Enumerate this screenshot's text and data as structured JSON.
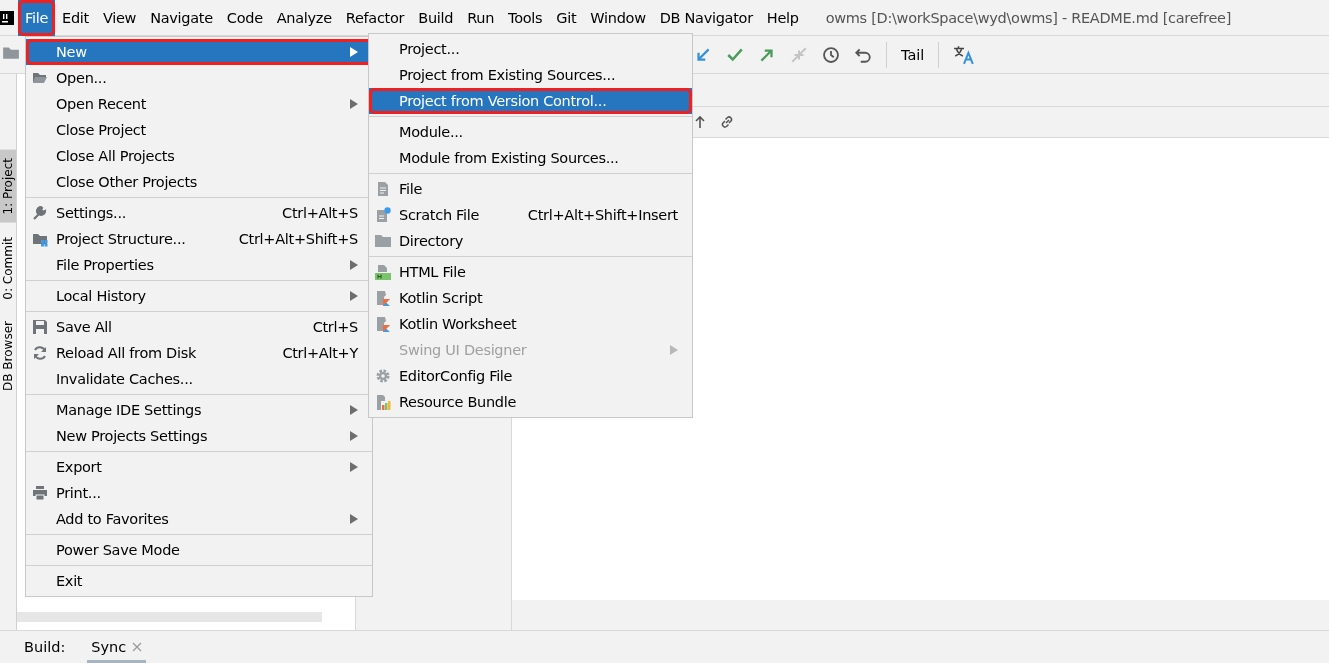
{
  "menubar": {
    "items": [
      {
        "label": "File",
        "selected": true,
        "annotated": true
      },
      {
        "label": "Edit",
        "selected": false,
        "annotated": false
      },
      {
        "label": "View",
        "selected": false,
        "annotated": false
      },
      {
        "label": "Navigate",
        "selected": false,
        "annotated": false
      },
      {
        "label": "Code",
        "selected": false,
        "annotated": false
      },
      {
        "label": "Analyze",
        "selected": false,
        "annotated": false
      },
      {
        "label": "Refactor",
        "selected": false,
        "annotated": false
      },
      {
        "label": "Build",
        "selected": false,
        "annotated": false
      },
      {
        "label": "Run",
        "selected": false,
        "annotated": false
      },
      {
        "label": "Tools",
        "selected": false,
        "annotated": false
      },
      {
        "label": "Git",
        "selected": false,
        "annotated": false
      },
      {
        "label": "Window",
        "selected": false,
        "annotated": false
      },
      {
        "label": "DB Navigator",
        "selected": false,
        "annotated": false
      },
      {
        "label": "Help",
        "selected": false,
        "annotated": false
      }
    ],
    "title": "owms [D:\\workSpace\\wyd\\owms] - README.md [carefree]"
  },
  "toolbar": {
    "tail_label": "Tail"
  },
  "side_tabs": [
    {
      "label": "1: Project",
      "selected": true
    },
    {
      "label": "0: Commit",
      "selected": false
    },
    {
      "label": "DB Browser",
      "selected": false
    }
  ],
  "file_menu": [
    {
      "kind": "item",
      "label": "New",
      "submenu": true,
      "selected": true,
      "annotated": true
    },
    {
      "kind": "item",
      "label": "Open...",
      "submenu": false,
      "selected": false,
      "annotated": false
    },
    {
      "kind": "item",
      "label": "Open Recent",
      "submenu": true,
      "selected": false,
      "annotated": false
    },
    {
      "kind": "item",
      "label": "Close Project",
      "submenu": false,
      "selected": false,
      "annotated": false
    },
    {
      "kind": "item",
      "label": "Close All Projects",
      "submenu": false,
      "selected": false,
      "annotated": false
    },
    {
      "kind": "item",
      "label": "Close Other Projects",
      "submenu": false,
      "selected": false,
      "annotated": false
    },
    {
      "kind": "separator"
    },
    {
      "kind": "item",
      "label": "Settings...",
      "shortcut": "Ctrl+Alt+S",
      "submenu": false,
      "selected": false,
      "annotated": false
    },
    {
      "kind": "item",
      "label": "Project Structure...",
      "shortcut": "Ctrl+Alt+Shift+S",
      "submenu": false,
      "selected": false,
      "annotated": false
    },
    {
      "kind": "item",
      "label": "File Properties",
      "submenu": true,
      "selected": false,
      "annotated": false
    },
    {
      "kind": "separator"
    },
    {
      "kind": "item",
      "label": "Local History",
      "submenu": true,
      "selected": false,
      "annotated": false
    },
    {
      "kind": "separator"
    },
    {
      "kind": "item",
      "label": "Save All",
      "shortcut": "Ctrl+S",
      "submenu": false,
      "selected": false,
      "annotated": false
    },
    {
      "kind": "item",
      "label": "Reload All from Disk",
      "shortcut": "Ctrl+Alt+Y",
      "submenu": false,
      "selected": false,
      "annotated": false
    },
    {
      "kind": "item",
      "label": "Invalidate Caches...",
      "submenu": false,
      "selected": false,
      "annotated": false
    },
    {
      "kind": "separator"
    },
    {
      "kind": "item",
      "label": "Manage IDE Settings",
      "submenu": true,
      "selected": false,
      "annotated": false
    },
    {
      "kind": "item",
      "label": "New Projects Settings",
      "submenu": true,
      "selected": false,
      "annotated": false
    },
    {
      "kind": "separator"
    },
    {
      "kind": "item",
      "label": "Export",
      "submenu": true,
      "selected": false,
      "annotated": false
    },
    {
      "kind": "item",
      "label": "Print...",
      "submenu": false,
      "selected": false,
      "annotated": false
    },
    {
      "kind": "item",
      "label": "Add to Favorites",
      "submenu": true,
      "selected": false,
      "annotated": false
    },
    {
      "kind": "separator"
    },
    {
      "kind": "item",
      "label": "Power Save Mode",
      "submenu": false,
      "selected": false,
      "annotated": false
    },
    {
      "kind": "separator"
    },
    {
      "kind": "item",
      "label": "Exit",
      "submenu": false,
      "selected": false,
      "annotated": false
    }
  ],
  "new_submenu": [
    {
      "kind": "item",
      "label": "Project...",
      "submenu": false,
      "selected": false,
      "disabled": false,
      "annotated": false
    },
    {
      "kind": "item",
      "label": "Project from Existing Sources...",
      "submenu": false,
      "selected": false,
      "disabled": false,
      "annotated": false
    },
    {
      "kind": "item",
      "label": "Project from Version Control...",
      "submenu": false,
      "selected": true,
      "disabled": false,
      "annotated": true
    },
    {
      "kind": "separator"
    },
    {
      "kind": "item",
      "label": "Module...",
      "submenu": false,
      "selected": false,
      "disabled": false,
      "annotated": false
    },
    {
      "kind": "item",
      "label": "Module from Existing Sources...",
      "submenu": false,
      "selected": false,
      "disabled": false,
      "annotated": false
    },
    {
      "kind": "separator"
    },
    {
      "kind": "item",
      "label": "File",
      "submenu": false,
      "selected": false,
      "disabled": false,
      "annotated": false
    },
    {
      "kind": "item",
      "label": "Scratch File",
      "shortcut": "Ctrl+Alt+Shift+Insert",
      "submenu": false,
      "selected": false,
      "disabled": false,
      "annotated": false
    },
    {
      "kind": "item",
      "label": "Directory",
      "submenu": false,
      "selected": false,
      "disabled": false,
      "annotated": false
    },
    {
      "kind": "separator"
    },
    {
      "kind": "item",
      "label": "HTML File",
      "submenu": false,
      "selected": false,
      "disabled": false,
      "annotated": false
    },
    {
      "kind": "item",
      "label": "Kotlin Script",
      "submenu": false,
      "selected": false,
      "disabled": false,
      "annotated": false
    },
    {
      "kind": "item",
      "label": "Kotlin Worksheet",
      "submenu": false,
      "selected": false,
      "disabled": false,
      "annotated": false
    },
    {
      "kind": "item",
      "label": "Swing UI Designer",
      "submenu": true,
      "selected": false,
      "disabled": true,
      "annotated": false
    },
    {
      "kind": "item",
      "label": "EditorConfig File",
      "submenu": false,
      "selected": false,
      "disabled": false,
      "annotated": false
    },
    {
      "kind": "item",
      "label": "Resource Bundle",
      "submenu": false,
      "selected": false,
      "disabled": false,
      "annotated": false
    }
  ],
  "bottom_bar": {
    "label": "Build:",
    "tabs": [
      {
        "label": "Sync",
        "selected": true
      }
    ]
  }
}
